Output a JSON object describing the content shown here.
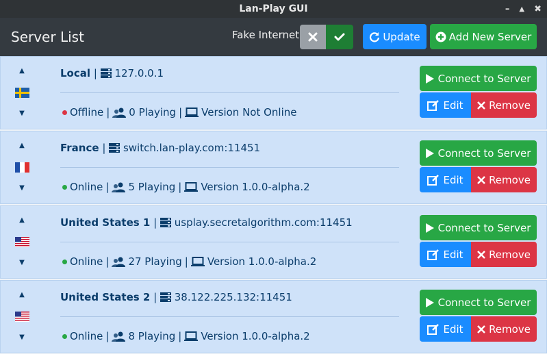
{
  "window": {
    "title": "Lan-Play GUI",
    "controls": [
      "–",
      "▲",
      "✖"
    ]
  },
  "header": {
    "title": "Server List",
    "fake_internet_label": "Fake Internet:",
    "update_label": "Update",
    "add_label": "Add New Server"
  },
  "servers": [
    {
      "name": "Local",
      "address": "127.0.0.1",
      "status": "Offline",
      "status_color": "#dc3545",
      "playing": "0 Playing",
      "version": "Version Not Online",
      "flag": "sweden"
    },
    {
      "name": "France",
      "address": "switch.lan-play.com:11451",
      "status": "Online",
      "status_color": "#28a745",
      "playing": "5 Playing",
      "version": "Version 1.0.0-alpha.2",
      "flag": "france"
    },
    {
      "name": "United States 1",
      "address": "usplay.secretalgorithm.com:11451",
      "status": "Online",
      "status_color": "#28a745",
      "playing": "27 Playing",
      "version": "Version 1.0.0-alpha.2",
      "flag": "usa"
    },
    {
      "name": "United States 2",
      "address": "38.122.225.132:11451",
      "status": "Online",
      "status_color": "#28a745",
      "playing": "8 Playing",
      "version": "Version 1.0.0-alpha.2",
      "flag": "usa"
    }
  ],
  "buttons": {
    "connect": "Connect to Server",
    "edit": "Edit",
    "remove": "Remove"
  },
  "separators": {
    "pipe": "|"
  }
}
